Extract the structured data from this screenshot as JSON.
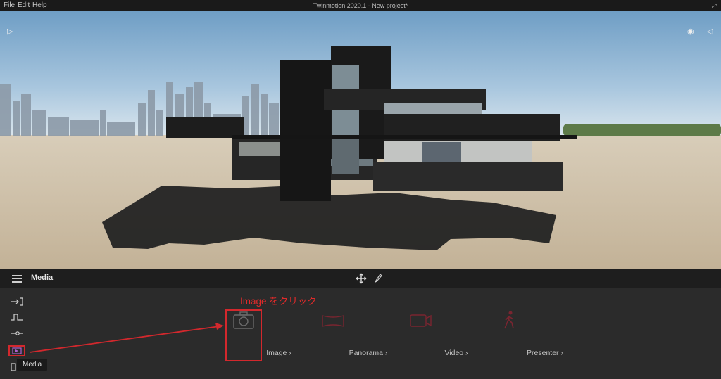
{
  "titlebar": {
    "menu": [
      "File",
      "Edit",
      "Help"
    ],
    "title": "Twinmotion 2020.1 - New project*"
  },
  "panel": {
    "title": "Media",
    "items": [
      {
        "label": "Image",
        "icon": "camera-icon"
      },
      {
        "label": "Panorama",
        "icon": "panorama-icon"
      },
      {
        "label": "Video",
        "icon": "video-camera-icon"
      },
      {
        "label": "Presenter",
        "icon": "presenter-walk-icon"
      }
    ],
    "tooltip": "Media"
  },
  "annotation": {
    "text": "Image をクリック",
    "color": "#d3282d"
  },
  "colors": {
    "accent": "#d3282d",
    "panel_bg": "#2b2b2b",
    "header_bg": "#1e1e1e"
  }
}
